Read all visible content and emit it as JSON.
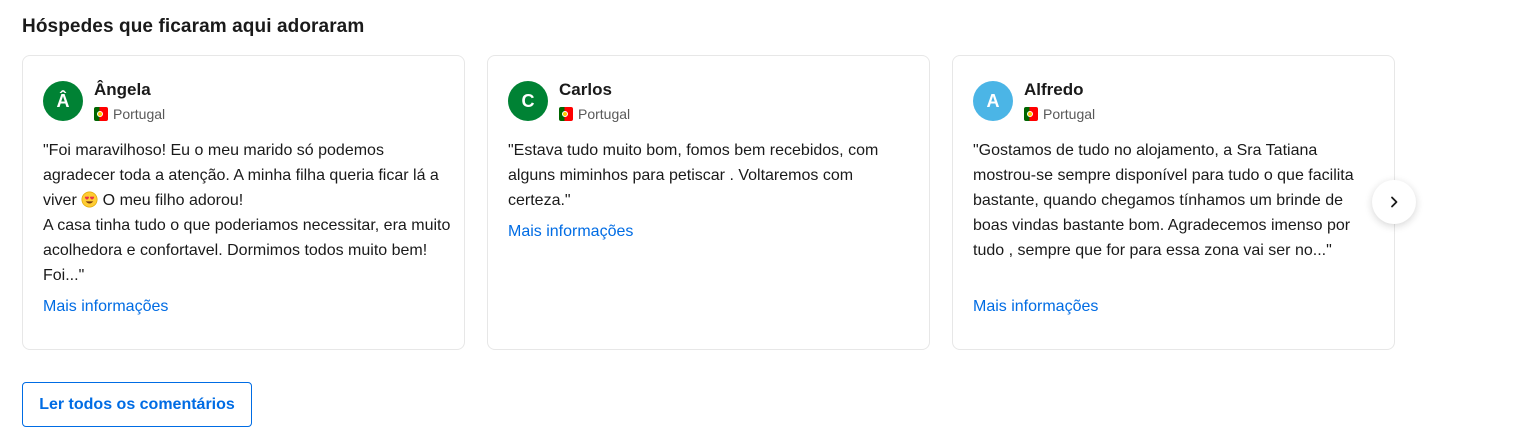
{
  "section": {
    "title": "Hóspedes que ficaram aqui adoraram"
  },
  "reviews": [
    {
      "initial": "Â",
      "name": "Ângela",
      "country": "Portugal",
      "avatar_color": "#008234",
      "text_before_emoji": "\"Foi maravilhoso! Eu o meu marido só podemos agradecer toda a atenção. A minha filha queria ficar lá a viver ",
      "emoji": "smiling-face-with-heart-eyes",
      "text_after_emoji": " O meu filho adorou!\nA casa tinha tudo o que poderiamos necessitar, era muito acolhedora e confortavel. Dormimos todos muito bem! Foi...\"",
      "more_label": "Mais informações"
    },
    {
      "initial": "C",
      "name": "Carlos",
      "country": "Portugal",
      "avatar_color": "#008234",
      "text": "\"Estava tudo muito bom, fomos bem recebidos, com alguns miminhos para petiscar . Voltaremos com certeza.\"",
      "more_label": "Mais informações"
    },
    {
      "initial": "A",
      "name": "Alfredo",
      "country": "Portugal",
      "avatar_color": "#4bb5e6",
      "text": "\"Gostamos de tudo no alojamento, a Sra Tatiana mostrou-se sempre disponível para tudo o que facilita bastante, quando chegamos tínhamos um brinde de boas vindas bastante bom. Agradecemos imenso por tudo , sempre que for para essa zona vai ser no...\"",
      "more_label": "Mais informações"
    }
  ],
  "carousel": {
    "next_icon": "chevron-right-icon"
  },
  "footer": {
    "read_all_label": "Ler todos os comentários"
  },
  "colors": {
    "link": "#006ce4",
    "border": "#e7e7e7",
    "text": "#1a1a1a",
    "muted": "#595959"
  }
}
